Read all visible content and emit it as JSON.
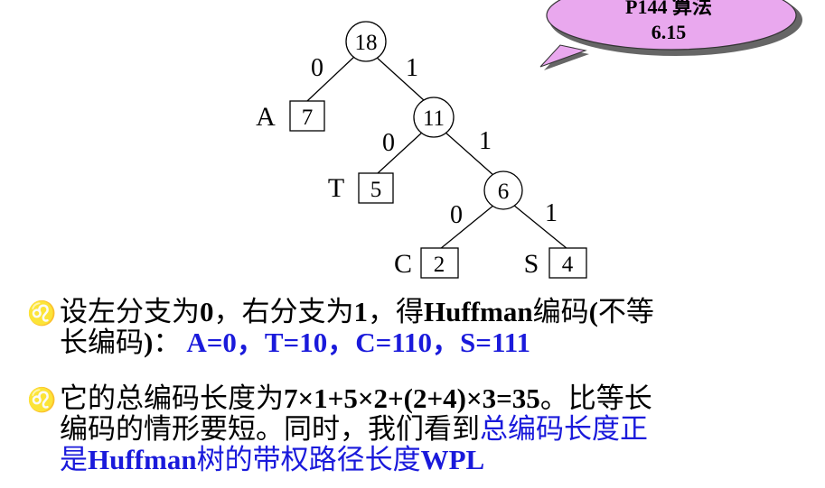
{
  "callout": {
    "line1": "P144 算法",
    "line2": "6.15"
  },
  "tree": {
    "nodes": {
      "root": "18",
      "mid": "11",
      "low": "6"
    },
    "leaves": {
      "a": {
        "letter": "A",
        "weight": "7"
      },
      "t": {
        "letter": "T",
        "weight": "5"
      },
      "c": {
        "letter": "C",
        "weight": "2"
      },
      "s": {
        "letter": "S",
        "weight": "4"
      }
    },
    "edges": {
      "root_left": "0",
      "root_right": "1",
      "mid_left": "0",
      "mid_right": "1",
      "low_left": "0",
      "low_right": "1"
    }
  },
  "bullets": {
    "mark": "♌",
    "b1": {
      "l1_a": "设左分支为",
      "l1_b": "0",
      "l1_c": "，右分支为",
      "l1_d": "1",
      "l1_e": "，得",
      "l1_f": "Huffman",
      "l1_g": "编码",
      "l1_h": "(",
      "l1_i": "不等",
      "l2_a": "长编码",
      "l2_b": ")",
      "l2_c": "：",
      "l2_codes": "A=0，T=10，C=110，S=111"
    },
    "b2": {
      "l1_a": "它的总编码长度为",
      "l1_b": "7×1+5×2+(2+4)×3=35",
      "l1_c": "。比等长",
      "l2_a": "编码的情形要短。同时，我们看到",
      "l2_b": "总编码长度正",
      "l3_a": "是",
      "l3_b": "Huffman",
      "l3_c": "树的带权路径长度",
      "l3_d": "WPL"
    }
  }
}
